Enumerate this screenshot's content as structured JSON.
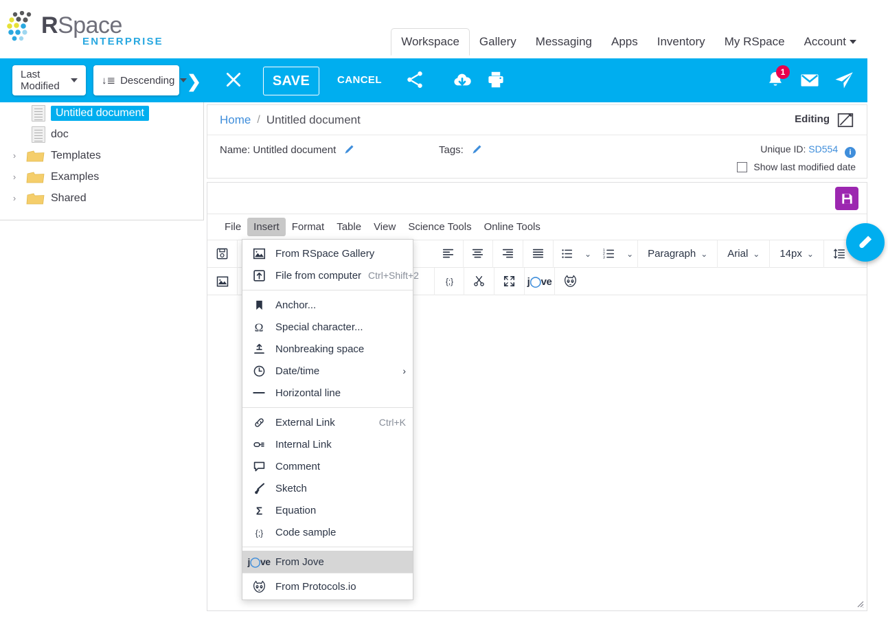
{
  "brand": {
    "name_r": "R",
    "name_space": "Space",
    "edition": "ENTERPRISE",
    "accent_blue": "#00AEEF",
    "logo_yellow": "#e6e137",
    "logo_gray": "#6f6f7a"
  },
  "mainnav": {
    "items": [
      {
        "label": "Workspace",
        "active": true
      },
      {
        "label": "Gallery",
        "active": false
      },
      {
        "label": "Messaging",
        "active": false
      },
      {
        "label": "Apps",
        "active": false
      },
      {
        "label": "Inventory",
        "active": false
      },
      {
        "label": "My RSpace",
        "active": false
      },
      {
        "label": "Account",
        "active": false,
        "has_caret": true
      }
    ]
  },
  "sortbar": {
    "sort_field": "Last Modified",
    "sort_order": "Descending",
    "sort_icon": "sort-descending-icon",
    "expand_icon": "chevron-right-icon"
  },
  "tree": {
    "items": [
      {
        "label": "Untitled document",
        "type": "document",
        "selected": true,
        "expandable": false
      },
      {
        "label": "doc",
        "type": "document",
        "selected": false,
        "expandable": false
      },
      {
        "label": "Templates",
        "type": "folder",
        "selected": false,
        "expandable": true
      },
      {
        "label": "Examples",
        "type": "folder",
        "selected": false,
        "expandable": true
      },
      {
        "label": "Shared",
        "type": "folder",
        "selected": false,
        "expandable": true
      }
    ]
  },
  "actionbar": {
    "close_label": "close-icon",
    "save_label": "SAVE",
    "cancel_label": "CANCEL",
    "share_icon": "share-nodes-icon",
    "download_icon": "cloud-download-icon",
    "print_icon": "printer-icon",
    "notifications_icon": "bell-icon",
    "notifications_count": "1",
    "messages_icon": "envelope-icon",
    "send_icon": "paper-plane-icon"
  },
  "docpanel": {
    "breadcrumb_home": "Home",
    "breadcrumb_sep": "/",
    "breadcrumb_current": "Untitled  document",
    "editing_label": "Editing",
    "editing_icon": "edit-square-icon",
    "name_label": "Name: Untitled document",
    "name_edit_icon": "pencil-icon",
    "tags_label": "Tags:",
    "tags_edit_icon": "pencil-icon",
    "unique_id_label": "Unique ID:",
    "unique_id_value": "SD554",
    "info_icon": "info-icon",
    "show_modified_label": "Show last modified date",
    "show_modified_checked": false
  },
  "editor": {
    "quick_save_icon": "floppy-disk-icon",
    "quick_save_color": "#9c27b0",
    "menus": [
      {
        "label": "File",
        "open": false
      },
      {
        "label": "Insert",
        "open": true
      },
      {
        "label": "Format",
        "open": false
      },
      {
        "label": "Table",
        "open": false
      },
      {
        "label": "View",
        "open": false
      },
      {
        "label": "Science Tools",
        "open": false
      },
      {
        "label": "Online Tools",
        "open": false
      }
    ],
    "toolbar_row1_icons": [
      "save-icon",
      "align-left-icon",
      "align-center-icon",
      "align-right-icon",
      "align-justify-icon",
      "bullet-list-icon",
      "bullet-list-chevron-icon",
      "numbered-list-icon",
      "numbered-list-chevron-icon"
    ],
    "toolbar_row2_icons": [
      "insert-image-icon",
      "code-sample-icon",
      "scissors-icon",
      "fullscreen-icon",
      "jove-icon",
      "protocols-io-icon"
    ],
    "style_dropdowns": [
      {
        "label": "Paragraph",
        "name": "block-format-select"
      },
      {
        "label": "Arial",
        "name": "font-family-select"
      },
      {
        "label": "14px",
        "name": "font-size-select"
      }
    ],
    "line_height_icon": "line-height-icon",
    "body_text": "",
    "resize_handle_icon": "resize-handle-icon"
  },
  "insert_menu": {
    "groups": [
      {
        "items": [
          {
            "label": "From RSpace Gallery",
            "icon": "image-gallery-icon",
            "shortcut": "",
            "submenu": false,
            "hover": false
          },
          {
            "label": "File from computer",
            "icon": "upload-file-icon",
            "shortcut": "Ctrl+Shift+2",
            "submenu": false,
            "hover": false
          }
        ]
      },
      {
        "items": [
          {
            "label": "Anchor...",
            "icon": "bookmark-icon",
            "shortcut": "",
            "submenu": false,
            "hover": false
          },
          {
            "label": "Special character...",
            "icon": "omega-icon",
            "shortcut": "",
            "submenu": false,
            "hover": false
          },
          {
            "label": "Nonbreaking space",
            "icon": "nonbreaking-space-icon",
            "shortcut": "",
            "submenu": false,
            "hover": false
          },
          {
            "label": "Date/time",
            "icon": "clock-icon",
            "shortcut": "",
            "submenu": true,
            "hover": false
          },
          {
            "label": "Horizontal line",
            "icon": "horizontal-line-icon",
            "shortcut": "",
            "submenu": false,
            "hover": false
          }
        ]
      },
      {
        "items": [
          {
            "label": "External Link",
            "icon": "link-icon",
            "shortcut": "Ctrl+K",
            "submenu": false,
            "hover": false
          },
          {
            "label": "Internal Link",
            "icon": "internal-link-icon",
            "shortcut": "",
            "submenu": false,
            "hover": false
          },
          {
            "label": "Comment",
            "icon": "comment-icon",
            "shortcut": "",
            "submenu": false,
            "hover": false
          },
          {
            "label": "Sketch",
            "icon": "brush-icon",
            "shortcut": "",
            "submenu": false,
            "hover": false
          },
          {
            "label": "Equation",
            "icon": "sigma-icon",
            "shortcut": "",
            "submenu": false,
            "hover": false
          },
          {
            "label": "Code sample",
            "icon": "code-sample-icon",
            "shortcut": "",
            "submenu": false,
            "hover": false
          }
        ]
      },
      {
        "items": [
          {
            "label": "From Jove",
            "icon": "jove-icon",
            "shortcut": "",
            "submenu": false,
            "hover": true
          }
        ]
      },
      {
        "items": [
          {
            "label": "From Protocols.io",
            "icon": "protocols-io-icon",
            "shortcut": "",
            "submenu": false,
            "hover": false
          }
        ]
      }
    ]
  },
  "fab": {
    "icon": "test-tube-icon",
    "color": "#00AEEF"
  }
}
